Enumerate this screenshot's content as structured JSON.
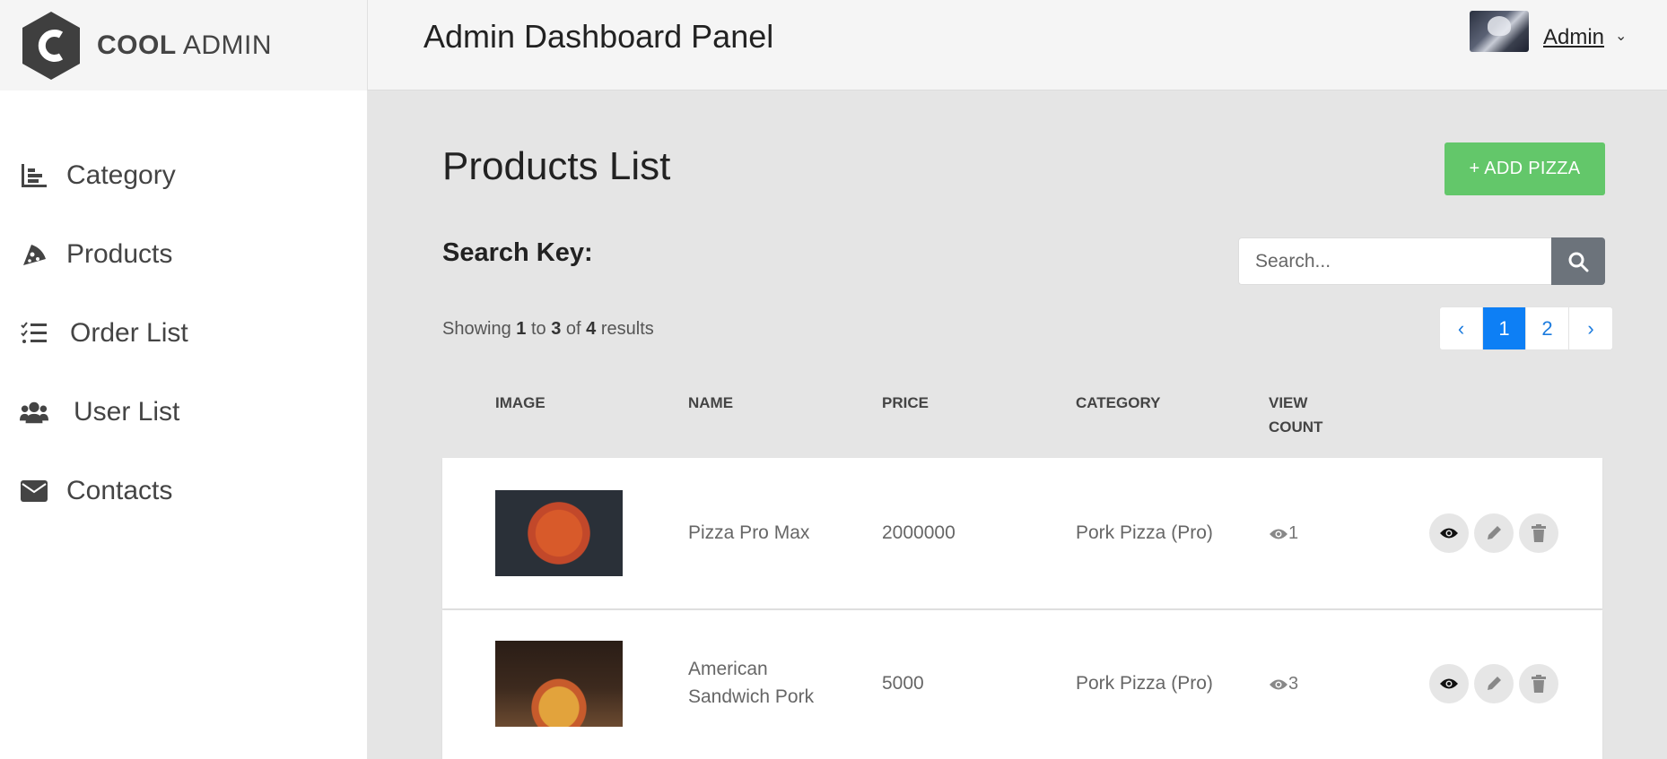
{
  "brand": {
    "bold": "COOL",
    "light": "ADMIN"
  },
  "header": {
    "title": "Admin Dashboard Panel",
    "user_name": "Admin",
    "user_caret": "⌄"
  },
  "sidebar": {
    "items": [
      {
        "label": "Category",
        "icon": "bar-chart-icon"
      },
      {
        "label": "Products",
        "icon": "pizza-slice-icon"
      },
      {
        "label": "Order List",
        "icon": "checklist-icon"
      },
      {
        "label": "User List",
        "icon": "users-icon"
      },
      {
        "label": "Contacts",
        "icon": "envelope-icon"
      }
    ]
  },
  "main": {
    "page_title": "Products List",
    "add_button": "+ ADD PIZZA",
    "search_label": "Search Key:",
    "search_placeholder": "Search...",
    "showing": {
      "prefix": "Showing",
      "from": "1",
      "to_word": "to",
      "to": "3",
      "of_word": "of",
      "total": "4",
      "suffix": "results"
    },
    "pagination": {
      "prev": "‹",
      "pages": [
        "1",
        "2"
      ],
      "next": "›",
      "active": "1"
    },
    "columns": [
      "IMAGE",
      "NAME",
      "PRICE",
      "CATEGORY",
      "VIEW COUNT"
    ],
    "rows": [
      {
        "name": "Pizza Pro Max",
        "price": "2000000",
        "category": "Pork Pizza (Pro)",
        "views": "1"
      },
      {
        "name": "American Sandwich Pork",
        "price": "5000",
        "category": "Pork Pizza (Pro)",
        "views": "3"
      }
    ]
  },
  "colors": {
    "accent_green": "#63c76a",
    "pager_active": "#0d7ff5",
    "search_button": "#6c737b"
  }
}
